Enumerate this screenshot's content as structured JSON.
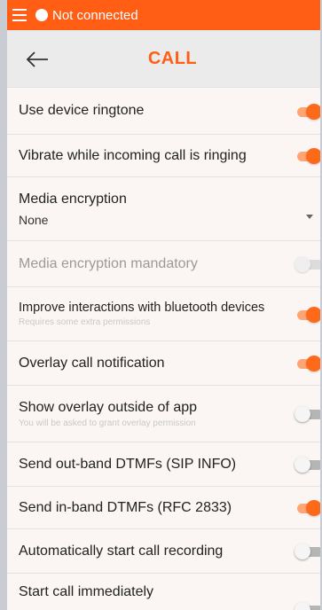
{
  "status": {
    "connection_text": "Not connected"
  },
  "header": {
    "title": "CALL"
  },
  "settings": {
    "use_ringtone": {
      "label": "Use device ringtone",
      "enabled": true
    },
    "vibrate": {
      "label": "Vibrate while incoming call is ringing",
      "enabled": true
    },
    "media_encryption": {
      "label": "Media encryption",
      "value": "None"
    },
    "encryption_mandatory": {
      "label": "Media encryption mandatory",
      "enabled": false,
      "disabled": true
    },
    "bluetooth": {
      "label": "Improve interactions with bluetooth devices",
      "sub": "Requires some extra permissions",
      "enabled": true
    },
    "overlay_notification": {
      "label": "Overlay call notification",
      "enabled": true
    },
    "overlay_outside": {
      "label": "Show overlay outside of app",
      "sub": "You will be asked to grant overlay permission",
      "enabled": false
    },
    "outband_dtmf": {
      "label": "Send out-band DTMFs (SIP INFO)",
      "enabled": false
    },
    "inband_dtmf": {
      "label": "Send in-band DTMFs (RFC 2833)",
      "enabled": true
    },
    "auto_record": {
      "label": "Automatically start call recording",
      "enabled": false
    },
    "start_immediately": {
      "label": "Start call immediately",
      "enabled": false
    }
  },
  "colors": {
    "accent": "#ff5e14",
    "header_bg": "#ebebeb",
    "page_bg": "#fbf6f3"
  }
}
